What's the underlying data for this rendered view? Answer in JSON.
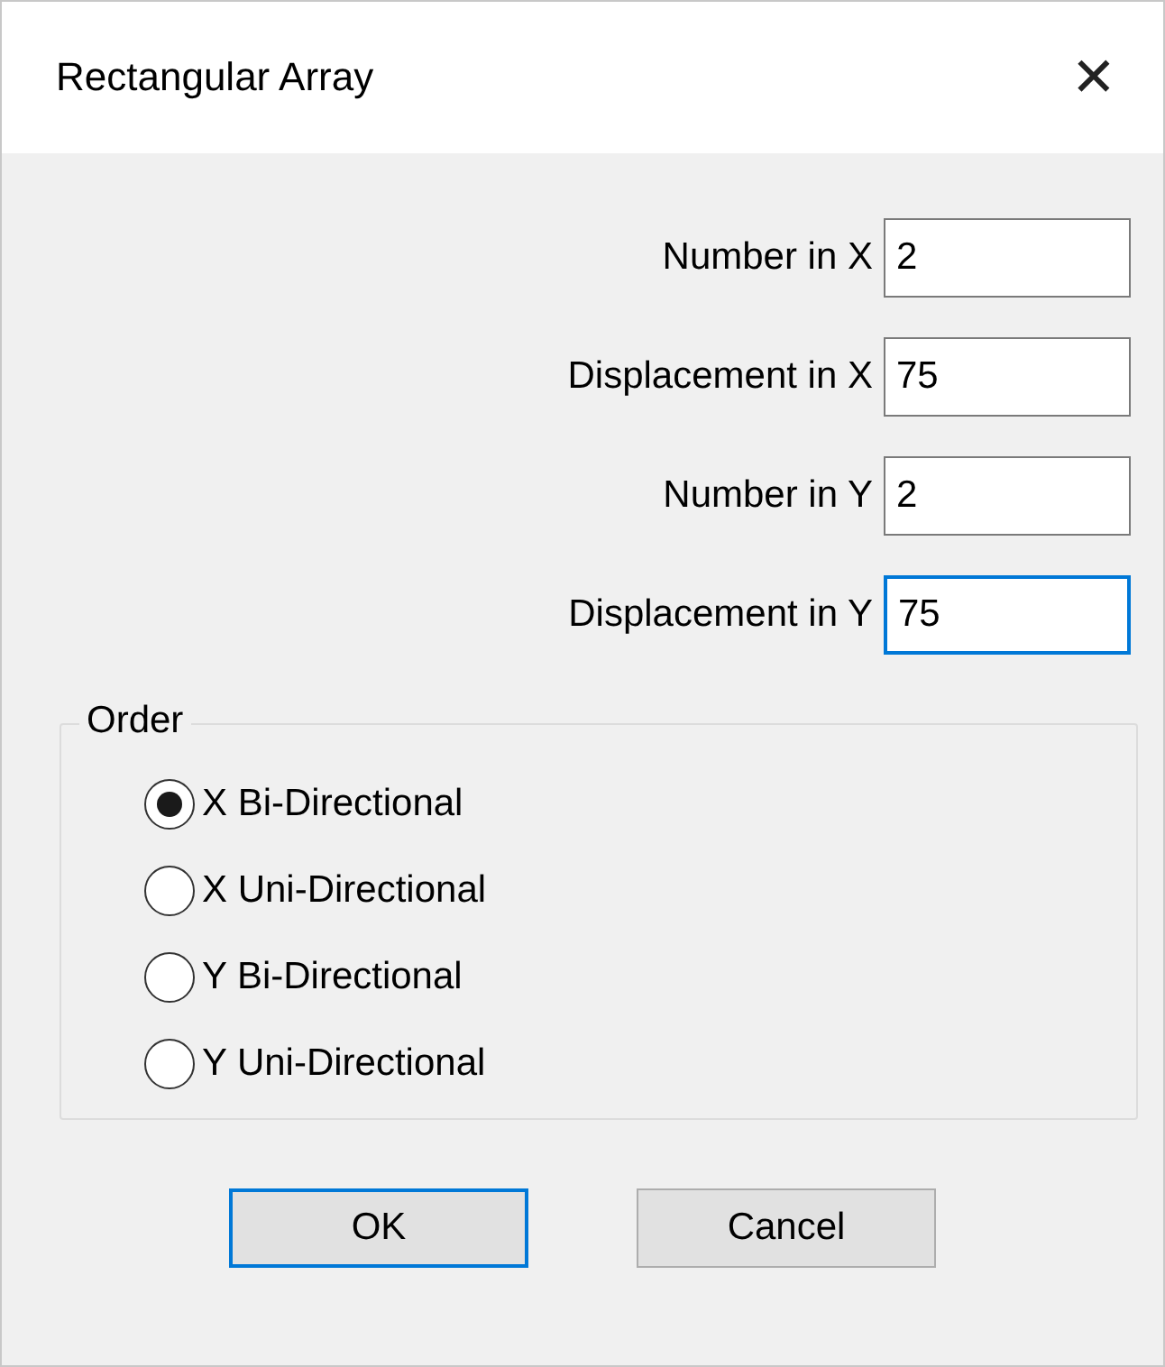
{
  "window": {
    "title": "Rectangular Array",
    "close": "✕"
  },
  "fields": [
    {
      "label": "Number in X",
      "value": "2",
      "focused": false
    },
    {
      "label": "Displacement in X",
      "value": "75",
      "focused": false
    },
    {
      "label": "Number in Y",
      "value": "2",
      "focused": false
    },
    {
      "label": "Displacement in Y",
      "value": "75",
      "focused": true
    }
  ],
  "order": {
    "title": "Order",
    "options": [
      {
        "label": "X Bi-Directional",
        "selected": true
      },
      {
        "label": "X Uni-Directional",
        "selected": false
      },
      {
        "label": "Y Bi-Directional",
        "selected": false
      },
      {
        "label": "Y Uni-Directional",
        "selected": false
      }
    ]
  },
  "buttons": [
    {
      "label": "OK",
      "default": true
    },
    {
      "label": "Cancel",
      "default": false
    }
  ]
}
